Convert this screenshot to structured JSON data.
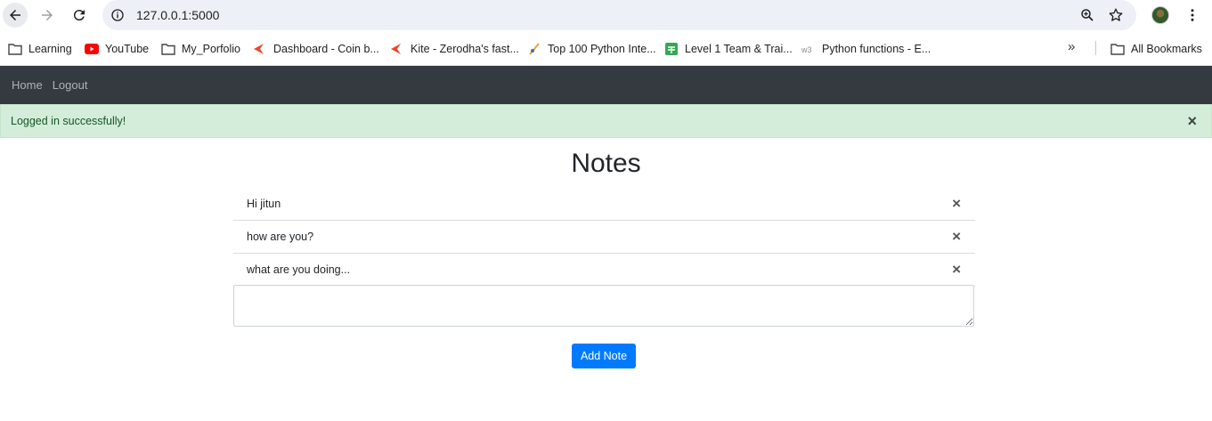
{
  "browser": {
    "url": "127.0.0.1:5000",
    "icons": [
      "back-icon",
      "forward-icon",
      "reload-icon",
      "info-icon",
      "zoom-icon",
      "star-icon",
      "avatar",
      "kebab-menu-icon"
    ]
  },
  "bookmarks": {
    "items": [
      {
        "label": "Learning",
        "icon": "folder-icon"
      },
      {
        "label": "YouTube",
        "icon": "youtube-icon"
      },
      {
        "label": "My_Porfolio",
        "icon": "folder-icon"
      },
      {
        "label": "Dashboard - Coin b...",
        "icon": "kite-icon"
      },
      {
        "label": "Kite - Zerodha's fast...",
        "icon": "kite-icon"
      },
      {
        "label": "Top 100 Python Inte...",
        "icon": "python-icon"
      },
      {
        "label": "Level 1 Team & Trai...",
        "icon": "sheets-icon"
      },
      {
        "label": "Python functions - E...",
        "icon": "w3-icon"
      }
    ],
    "more": "»",
    "all_bookmarks": "All Bookmarks"
  },
  "navbar": {
    "links": [
      "Home",
      "Logout"
    ],
    "background": "#343a40"
  },
  "alert": {
    "message": "Logged in successfully!",
    "close": "×",
    "color": "#d4edda"
  },
  "main": {
    "title": "Notes",
    "notes": [
      {
        "text": "Hi jitun",
        "delete": "×"
      },
      {
        "text": "how are you?",
        "delete": "×"
      },
      {
        "text": "what are you doing...",
        "delete": "×"
      }
    ],
    "input_value": "",
    "add_button": "Add Note",
    "accent": "#007bff"
  }
}
